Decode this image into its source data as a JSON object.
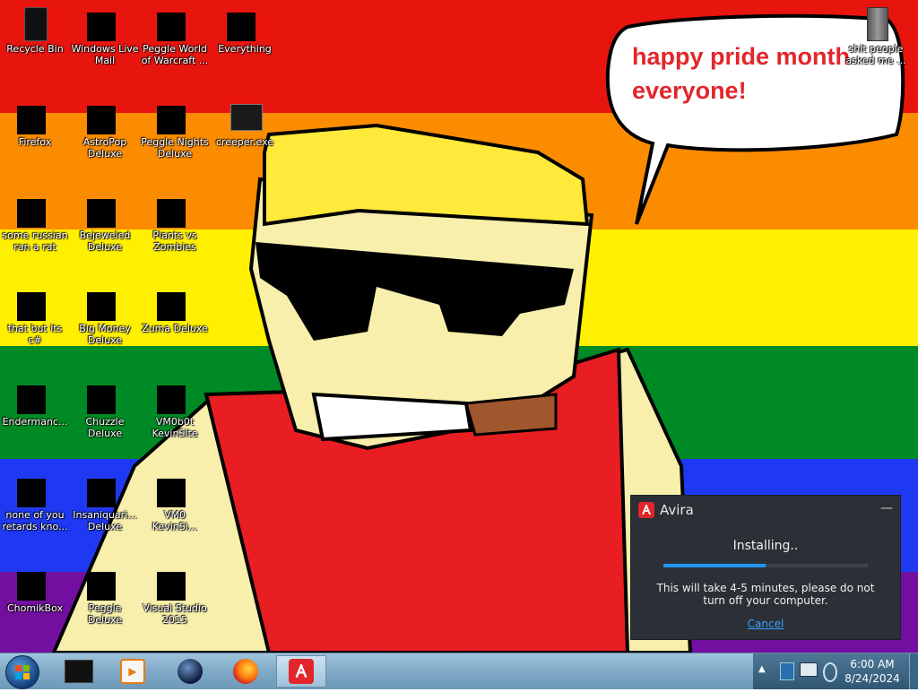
{
  "desktop": {
    "speech_bubble": "happy pride month everyone!",
    "icons": [
      {
        "label": "Recycle Bin"
      },
      {
        "label": "Windows Live Mail"
      },
      {
        "label": "Peggle World of Warcraft ..."
      },
      {
        "label": "Everything"
      },
      {
        "label": "Firefox"
      },
      {
        "label": "AstroPop Deluxe"
      },
      {
        "label": "Peggle Nights Deluxe"
      },
      {
        "label": "creeper.exe"
      },
      {
        "label": "some russian ran a rat"
      },
      {
        "label": "Bejeweled Deluxe"
      },
      {
        "label": "Plants vs Zombies"
      },
      {
        "label": "that but its c#"
      },
      {
        "label": "Big Money Deluxe"
      },
      {
        "label": "Zuma Deluxe"
      },
      {
        "label": "Endermanc..."
      },
      {
        "label": "Chuzzle Deluxe"
      },
      {
        "label": "VM0b0t KevinSite"
      },
      {
        "label": "none of you retards kno..."
      },
      {
        "label": "Insaniquari... Deluxe"
      },
      {
        "label": "VM0 KevinSi..."
      },
      {
        "label": "ChomikBox"
      },
      {
        "label": "Peggle Deluxe"
      },
      {
        "label": "Visual Studio 2015"
      },
      {
        "label": "shit people asked me ..."
      }
    ]
  },
  "avira_window": {
    "title": "Avira",
    "status": "Installing..",
    "progress_percent": 50,
    "message": "This will take 4-5 minutes, please do not turn off your computer.",
    "cancel_label": "Cancel",
    "accent_color": "#2196f3",
    "brand_color": "#e2262b"
  },
  "taskbar": {
    "items": [
      {
        "icon": "black-box-app-icon"
      },
      {
        "icon": "media-player-icon"
      },
      {
        "icon": "globe-icon"
      },
      {
        "icon": "firefox-icon"
      },
      {
        "icon": "avira-icon"
      }
    ],
    "clock": {
      "time": "6:00 AM",
      "date": "8/24/2024"
    }
  }
}
